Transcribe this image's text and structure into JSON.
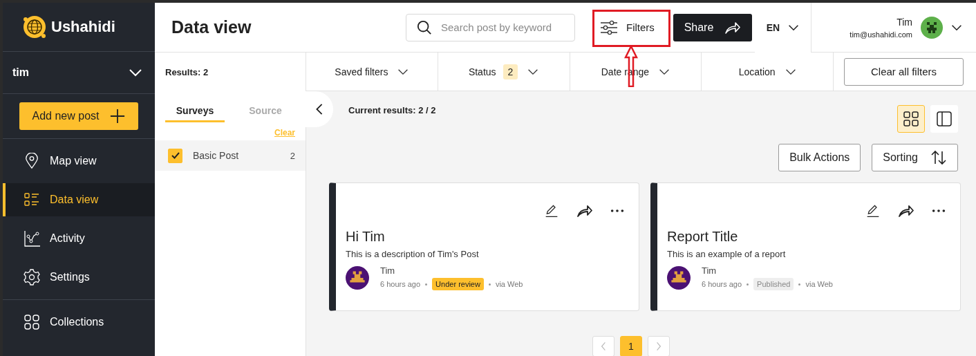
{
  "brand": {
    "name": "Ushahidi"
  },
  "sidebar": {
    "user": "tim",
    "add_button": "Add new post",
    "items": [
      {
        "label": "Map view",
        "kind": "map",
        "selected": false
      },
      {
        "label": "Data view",
        "kind": "data",
        "selected": true
      },
      {
        "label": "Activity",
        "kind": "activity",
        "selected": false
      },
      {
        "label": "Settings",
        "kind": "settings",
        "selected": false
      },
      {
        "label": "Collections",
        "kind": "collections",
        "selected": false
      }
    ]
  },
  "header": {
    "title": "Data view",
    "search": {
      "placeholder": "Search post by keyword"
    },
    "filters_button": "Filters",
    "share_button": "Share",
    "language": "EN",
    "user": {
      "name": "Tim",
      "email": "tim@ushahidi.com"
    }
  },
  "filter_panel": {
    "results": "Results: 2",
    "tabs": [
      {
        "label": "Surveys",
        "selected": true
      },
      {
        "label": "Source",
        "selected": false
      }
    ],
    "clear": "Clear",
    "surveys": [
      {
        "label": "Basic Post",
        "count": "2",
        "checked": true
      }
    ]
  },
  "filter_bar": {
    "filters": [
      {
        "label": "Saved filters"
      },
      {
        "label": "Status",
        "badge": "2"
      },
      {
        "label": "Date range"
      },
      {
        "label": "Location"
      }
    ],
    "clear_all": "Clear all filters"
  },
  "results": {
    "current": "Current results: 2 / 2",
    "view_modes": [
      {
        "kind": "grid",
        "selected": true
      },
      {
        "kind": "list",
        "selected": false
      }
    ],
    "bulk_actions": "Bulk Actions",
    "sorting": "Sorting"
  },
  "posts": [
    {
      "title": "Hi Tim",
      "description": "This is a description of Tim's Post",
      "author": "Tim",
      "time": "6 hours ago",
      "status": {
        "label": "Under review",
        "color": "#fdbf2d"
      },
      "source": "via Web"
    },
    {
      "title": "Report Title",
      "description": "This is an example of a report",
      "author": "Tim",
      "time": "6 hours ago",
      "status": {
        "label": "Published",
        "color": "#eeeeee"
      },
      "source": "via Web"
    }
  ],
  "pagination": {
    "pages": [
      {
        "label": "1",
        "selected": true
      }
    ]
  }
}
